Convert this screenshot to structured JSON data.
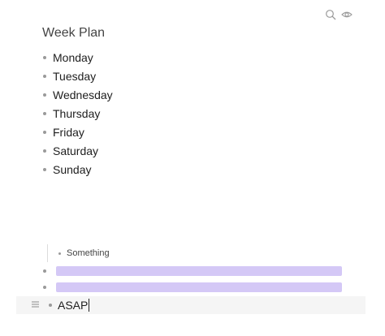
{
  "toolbar": {
    "icons": [
      "search-icon",
      "eye-icon"
    ]
  },
  "title": "Week Plan",
  "days": [
    "Monday",
    "Tuesday",
    "Wednesday",
    "Thursday",
    "Friday",
    "Saturday",
    "Sunday"
  ],
  "child_item": "Something",
  "highlight_color": "#d4c8f6",
  "active_item": "ASAP"
}
